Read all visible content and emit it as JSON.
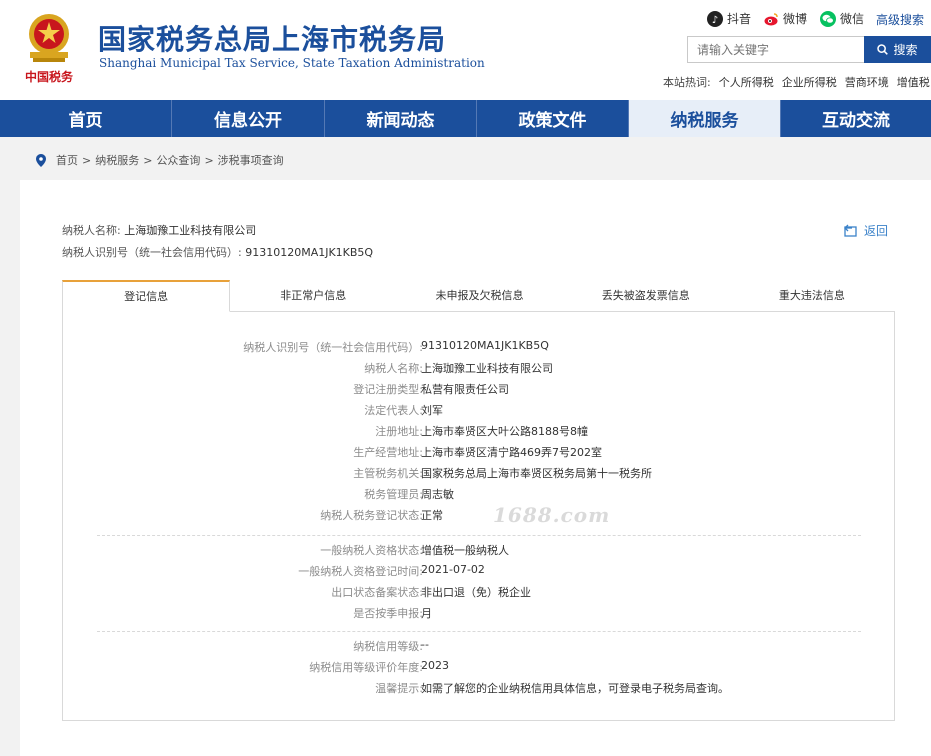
{
  "header": {
    "title_cn": "国家税务总局上海市税务局",
    "title_en": "Shanghai Municipal Tax Service, State Taxation Administration",
    "emblem_caption": "中国税务",
    "social": [
      {
        "label": "抖音",
        "icon": "tiktok-icon",
        "color": "#222222"
      },
      {
        "label": "微博",
        "icon": "weibo-icon",
        "color": "#e6162d"
      },
      {
        "label": "微信",
        "icon": "wechat-icon",
        "color": "#07c160"
      }
    ],
    "advanced_search": "高级搜索",
    "search_placeholder": "请输入关键字",
    "search_button": "搜索",
    "hotwords_label": "本站热词:",
    "hotwords": [
      "个人所得税",
      "企业所得税",
      "营商环境",
      "增值税"
    ]
  },
  "nav": {
    "items": [
      "首页",
      "信息公开",
      "新闻动态",
      "政策文件",
      "纳税服务",
      "互动交流"
    ],
    "active_index": 4
  },
  "breadcrumb": [
    "首页",
    "纳税服务",
    "公众查询",
    "涉税事项查询"
  ],
  "summary": {
    "name_label": "纳税人名称:",
    "name_value": "上海珈豫工业科技有限公司",
    "id_label": "纳税人识别号（统一社会信用代码）:",
    "id_value": "91310120MA1JK1KB5Q",
    "back_label": "返回"
  },
  "tabs": [
    "登记信息",
    "非正常户信息",
    "未申报及欠税信息",
    "丢失被盗发票信息",
    "重大违法信息"
  ],
  "active_tab": 0,
  "details": {
    "group1": [
      {
        "k": "纳税人识别号（统一社会信用代码）:",
        "v": "91310120MA1JK1KB5Q"
      },
      {
        "k": "纳税人名称:",
        "v": "上海珈豫工业科技有限公司"
      },
      {
        "k": "登记注册类型:",
        "v": "私营有限责任公司"
      },
      {
        "k": "法定代表人:",
        "v": "刘军"
      },
      {
        "k": "注册地址:",
        "v": "上海市奉贤区大叶公路8188号8幢"
      },
      {
        "k": "生产经营地址:",
        "v": "上海市奉贤区清宁路469弄7号202室"
      },
      {
        "k": "主管税务机关:",
        "v": "国家税务总局上海市奉贤区税务局第十一税务所"
      },
      {
        "k": "税务管理员:",
        "v": "周志敏"
      },
      {
        "k": "纳税人税务登记状态:",
        "v": "正常"
      }
    ],
    "group2": [
      {
        "k": "一般纳税人资格状态:",
        "v": "增值税一般纳税人"
      },
      {
        "k": "一般纳税人资格登记时间:",
        "v": "2021-07-02"
      },
      {
        "k": "出口状态备案状态:",
        "v": "非出口退（免）税企业"
      },
      {
        "k": "是否按季申报:",
        "v": "月"
      }
    ],
    "group3": [
      {
        "k": "纳税信用等级:",
        "v": "--"
      },
      {
        "k": "纳税信用等级评价年度:",
        "v": "2023"
      },
      {
        "k": "温馨提示:",
        "v": "如需了解您的企业纳税信用具体信息，可登录电子税务局查询。"
      }
    ]
  },
  "watermark": "1688.com"
}
